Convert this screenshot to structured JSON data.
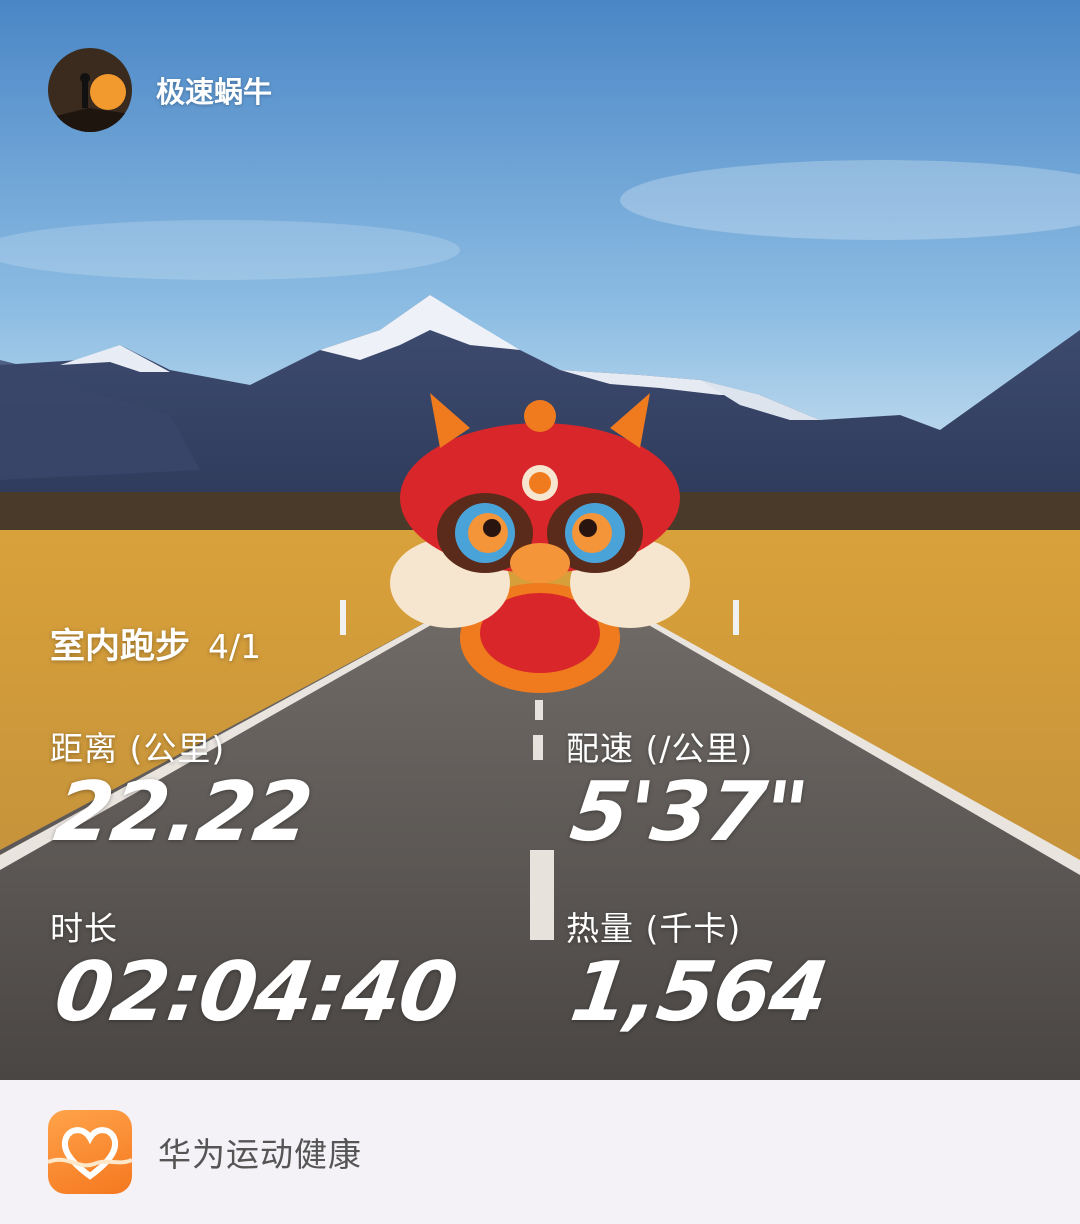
{
  "user": {
    "name": "极速蜗牛"
  },
  "activity": {
    "type": "室内跑步",
    "date": "4/1"
  },
  "metrics": {
    "distance": {
      "label": "距离 (公里)",
      "value": "22.22"
    },
    "pace": {
      "label": "配速 (/公里)",
      "value": "5'37\""
    },
    "duration": {
      "label": "时长",
      "value": "02:04:40"
    },
    "calories": {
      "label": "热量 (千卡)",
      "value": "1,564"
    }
  },
  "footer": {
    "app_name": "华为运动健康",
    "icon": "heart-icon"
  },
  "sticker": {
    "icon": "lion-dance-icon"
  },
  "colors": {
    "brand": "#f5781f",
    "footer_bg": "#f4f2f7"
  }
}
